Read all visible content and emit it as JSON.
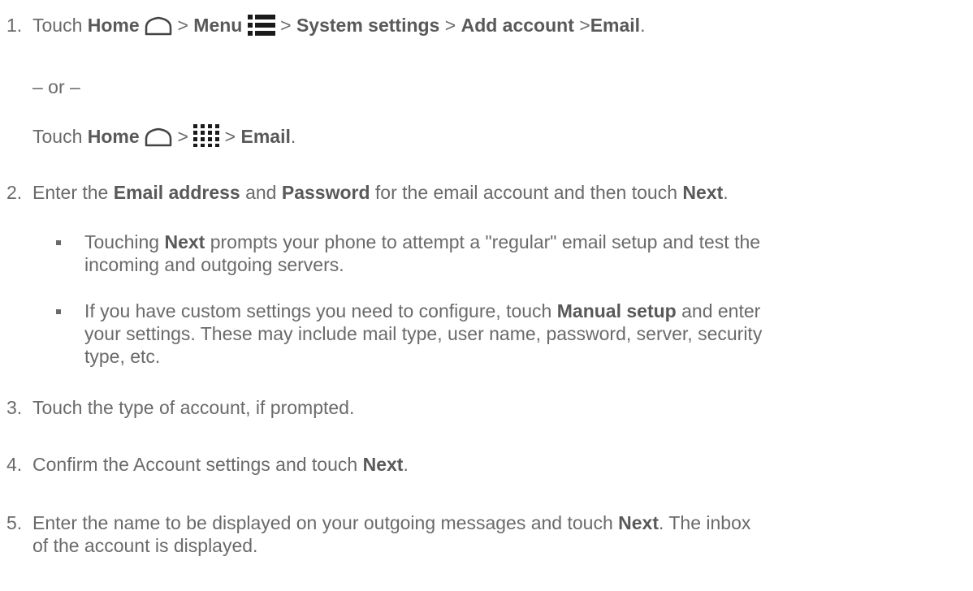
{
  "steps": [
    {
      "number": "1.",
      "line1": {
        "touch": "Touch",
        "home": "Home",
        "sep1": ">",
        "menu": "Menu",
        "sep2": ">",
        "system_settings": "System settings",
        "sep3": ">",
        "add_account": "Add account",
        "sep4": ">",
        "email": "Email",
        "end": "."
      },
      "or_text": "– or –",
      "line2": {
        "touch": "Touch",
        "home": "Home",
        "sep1": ">",
        "sep2": ">",
        "email": "Email",
        "end": "."
      }
    },
    {
      "number": "2.",
      "t1": "Enter the",
      "email_address": "Email address",
      "t2": "and",
      "password": "Password",
      "t3": "for the email account and then touch",
      "next": "Next",
      "end": ".",
      "bullets": [
        {
          "t1": "Touching",
          "next": "Next",
          "t2": "prompts your phone to attempt a \"regular\" email setup and test the",
          "l2": "incoming and outgoing servers."
        },
        {
          "t1": "If you have custom settings you need to configure, touch",
          "manual_setup": "Manual setup",
          "t2": "and enter",
          "l2": "your settings. These may include mail type, user name, password, server, security",
          "l3": "type, etc."
        }
      ]
    },
    {
      "number": "3.",
      "text": "Touch the type of account, if prompted."
    },
    {
      "number": "4.",
      "t1": "Confirm the Account settings and touch",
      "next": "Next",
      "end": "."
    },
    {
      "number": "5.",
      "t1": "Enter the name to be displayed on your outgoing messages and touch",
      "next": "Next",
      "t2": ". The inbox",
      "l2": "of the account is displayed."
    }
  ]
}
